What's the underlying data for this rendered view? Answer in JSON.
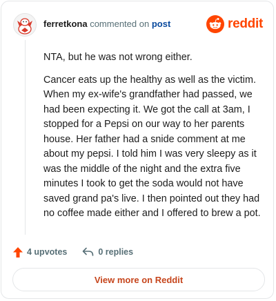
{
  "header": {
    "username": "ferretkona",
    "commented_on": "commented on",
    "post_link": "post",
    "logo_text": "reddit"
  },
  "comment": {
    "paragraphs": [
      "NTA, but he was not wrong either.",
      "Cancer eats up the healthy as well as the victim. When my ex-wife's grandfather had passed, we had been expecting it. We got the call at 3am, I stopped for a Pepsi on our way to her parents house. Her father had a snide comment at me about my pepsi. I told him I was very sleepy as it was the middle of the night and the extra five minutes I took to get the soda would not have saved grand pa's live. I then pointed out they had no coffee made either and I offered to brew a pot."
    ]
  },
  "actions": {
    "upvotes": "4 upvotes",
    "replies": "0 replies"
  },
  "footer": {
    "view_more": "View more on Reddit"
  },
  "colors": {
    "accent": "#ff4500",
    "link": "#0a4a9e",
    "muted": "#576f76"
  }
}
